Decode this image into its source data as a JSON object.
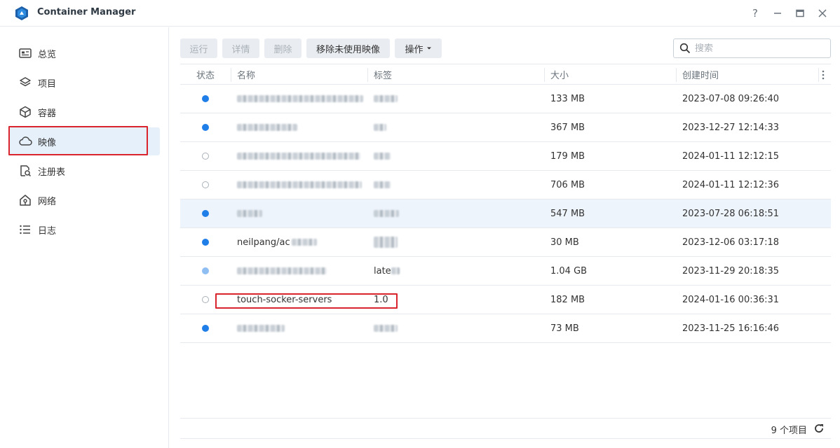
{
  "window": {
    "title": "Container Manager",
    "help_label": "?",
    "min_label": "—",
    "max_label": "□",
    "close_label": "✕"
  },
  "sidebar": {
    "items": [
      {
        "label": "总览",
        "icon": "overview-icon"
      },
      {
        "label": "项目",
        "icon": "layers-icon"
      },
      {
        "label": "容器",
        "icon": "cube-icon"
      },
      {
        "label": "映像",
        "icon": "cloud-icon",
        "active": true
      },
      {
        "label": "注册表",
        "icon": "registry-icon"
      },
      {
        "label": "网络",
        "icon": "network-icon"
      },
      {
        "label": "日志",
        "icon": "list-icon"
      }
    ]
  },
  "toolbar": {
    "run": "运行",
    "details": "详情",
    "delete": "删除",
    "remove_unused": "移除未使用映像",
    "actions": "操作",
    "search_placeholder": "搜索"
  },
  "table": {
    "headers": {
      "status": "状态",
      "name": "名称",
      "tag": "标签",
      "size": "大小",
      "created": "创建时间"
    },
    "rows": [
      {
        "status": "running",
        "name": "",
        "tag": "",
        "size": "133 MB",
        "created": "2023-07-08 09:26:40"
      },
      {
        "status": "running",
        "name": "",
        "tag": "",
        "size": "367 MB",
        "created": "2023-12-27 12:14:33"
      },
      {
        "status": "stopped",
        "name": "",
        "tag": "",
        "size": "179 MB",
        "created": "2024-01-11 12:12:15"
      },
      {
        "status": "stopped",
        "name": "",
        "tag": "",
        "size": "706 MB",
        "created": "2024-01-11 12:12:36"
      },
      {
        "status": "running",
        "name": "",
        "tag": "",
        "size": "547 MB",
        "created": "2023-07-28 06:18:51",
        "selected": true
      },
      {
        "status": "running",
        "name": "neilpang/ac",
        "tag": "",
        "size": "30 MB",
        "created": "2023-12-06 03:17:18"
      },
      {
        "status": "running",
        "name": "",
        "tag": "late",
        "size": "1.04 GB",
        "created": "2023-11-29 20:18:35"
      },
      {
        "status": "stopped",
        "name": "touch-socker-servers",
        "tag": "1.0",
        "size": "182 MB",
        "created": "2024-01-16 00:36:31",
        "highlighted": true
      },
      {
        "status": "running",
        "name": "",
        "tag": "",
        "size": "73 MB",
        "created": "2023-11-25 16:16:46"
      }
    ]
  },
  "footer": {
    "count": "9 个项目"
  },
  "colors": {
    "accent": "#1f7ee8",
    "highlight_border": "#d9232d",
    "selected_row": "#eef4fb"
  }
}
